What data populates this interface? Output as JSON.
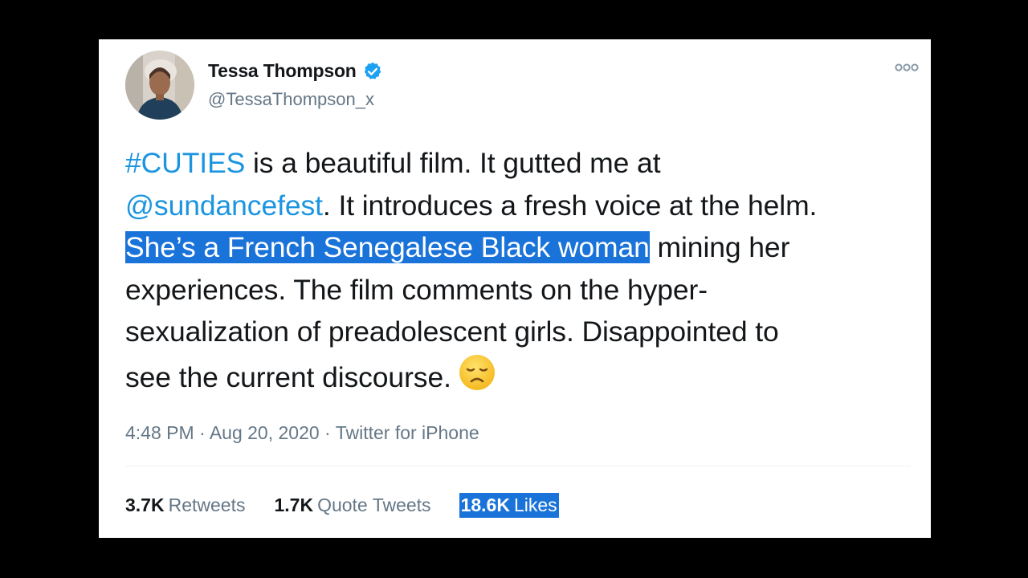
{
  "tweet": {
    "author": {
      "display_name": "Tessa Thompson",
      "handle": "@TessaThompson_x",
      "verified": true
    },
    "text": {
      "hashtag": "#CUTIES",
      "part1": " is a beautiful film. It gutted me at",
      "mention": "@sundancefest",
      "part2": ".  It introduces a fresh voice at the helm.",
      "selected": "She’s a French Senegalese Black woman",
      "part3": " mining her",
      "part4": "experiences. The film comments on the hyper-",
      "part5": "sexualization of preadolescent girls. Disappointed to",
      "part6": "see the current discourse.",
      "emoji": "disappointed-face-emoji"
    },
    "meta": {
      "time": "4:48 PM",
      "separator1": " · ",
      "date": "Aug 20, 2020",
      "separator2": " · ",
      "source": "Twitter for iPhone"
    },
    "stats": {
      "retweets_count": "3.7K",
      "retweets_label": "Retweets",
      "quotes_count": "1.7K",
      "quotes_label": "Quote Tweets",
      "likes_count": "18.6K",
      "likes_label": "Likes"
    }
  },
  "colors": {
    "background": "#000000",
    "card": "#ffffff",
    "link": "#1b95e0",
    "verified": "#1da1f2",
    "selection": "#1a73d9",
    "secondary_text": "#657786"
  },
  "icons": {
    "verified": "verified-badge-icon",
    "more": "more-options-icon"
  }
}
